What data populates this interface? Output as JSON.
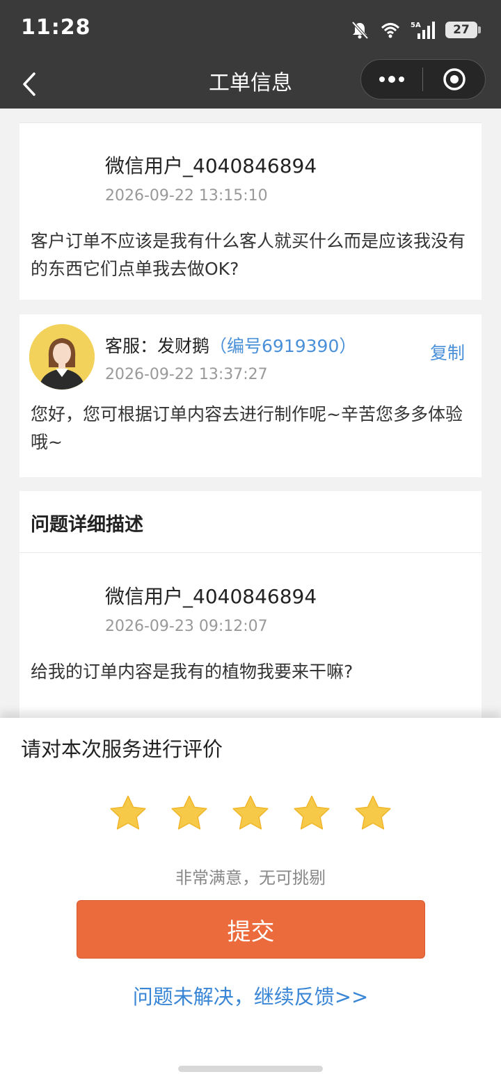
{
  "status_bar": {
    "time": "11:28",
    "battery": "27",
    "icons": [
      "mute-bell-icon",
      "wifi-icon",
      "signal-5a-icon",
      "battery-icon"
    ]
  },
  "nav": {
    "title": "工单信息",
    "back_icon": "chevron-left-icon",
    "more_icon": "more-dots-icon",
    "close_icon": "target-circle-icon"
  },
  "messages": [
    {
      "user": "微信用户_4040846894",
      "time": "2026-09-22 13:15:10",
      "text": "客户订单不应该是我有什么客人就买什么而是应该我没有的东西它们点单我去做OK?"
    },
    {
      "agent_prefix": "客服：发财鹅",
      "agent_id": "（编号6919390）",
      "time": "2026-09-22 13:37:27",
      "text": "您好，您可根据订单内容去进行制作呢~辛苦您多多体验哦~",
      "copy_label": "复制"
    }
  ],
  "detail_section": {
    "title": "问题详细描述",
    "user": "微信用户_4040846894",
    "time": "2026-09-23 09:12:07",
    "text": "给我的订单内容是我有的植物我要来干嘛?"
  },
  "rating": {
    "heading": "请对本次服务进行评价",
    "stars_selected": 5,
    "stars_total": 5,
    "star_color": "#f7c948",
    "result_text": "非常满意，无可挑剔",
    "submit_label": "提交",
    "feedback_link": "问题未解决，继续反馈>>"
  },
  "colors": {
    "header_bg": "#3a3a3a",
    "accent_orange": "#ec6b3c",
    "link_blue": "#4a90d9"
  }
}
